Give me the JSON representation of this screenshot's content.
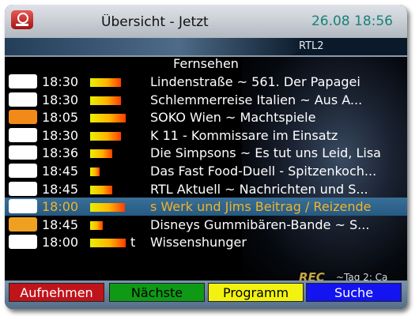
{
  "header": {
    "title": "Übersicht - Jetzt",
    "clock": "26.08 18:56",
    "channel": "RTL2"
  },
  "section_title": "Fernsehen",
  "rows": [
    {
      "logo": "festival",
      "time": "18:30",
      "progress": 0.85,
      "flag": "",
      "title": "Lindenstraße ~ 561. Der Papagei",
      "selected": false
    },
    {
      "logo": "plus",
      "time": "18:30",
      "progress": 0.85,
      "flag": "",
      "title": "Schlemmerreise Italien ~ Aus A...",
      "selected": false
    },
    {
      "logo": "zdf",
      "time": "18:05",
      "progress": 0.98,
      "flag": "",
      "title": "SOKO Wien ~ Machtspiele",
      "selected": false
    },
    {
      "logo": "sat1",
      "time": "18:30",
      "progress": 0.85,
      "flag": "",
      "title": "K 11 - Kommissare im Einsatz",
      "selected": false
    },
    {
      "logo": "pro7",
      "time": "18:36",
      "progress": 0.6,
      "flag": "",
      "title": "Die Simpsons ~ Es tut uns Leid, Lisa",
      "selected": false
    },
    {
      "logo": "kabel",
      "time": "18:45",
      "progress": 0.25,
      "flag": "",
      "title": "Das Fast Food-Duell - Spitzenkoch...",
      "selected": false
    },
    {
      "logo": "rtl",
      "time": "18:45",
      "progress": 0.6,
      "flag": "",
      "title": "RTL Aktuell ~ Nachrichten und S...",
      "selected": false
    },
    {
      "logo": "rtl2",
      "time": "18:00",
      "progress": 0.95,
      "flag": "",
      "title": "s Werk und Jims Beitrag / Reizende",
      "selected": true
    },
    {
      "logo": "super",
      "time": "18:45",
      "progress": 0.35,
      "flag": "",
      "title": "Disneys Gummibären-Bande ~ S...",
      "selected": false
    },
    {
      "logo": "vox",
      "time": "18:00",
      "progress": 0.97,
      "flag": "t",
      "title": "Wissenshunger",
      "selected": false
    }
  ],
  "rec": {
    "label": "REC",
    "tag": "~Tag 2: Ca"
  },
  "footer": {
    "red": "Aufnehmen",
    "green": "Nächste",
    "yellow": "Programm",
    "blue": "Suche"
  },
  "colors": {
    "header_clock": "#16827a",
    "selected_text": "#f2b42a",
    "selected_row": "#2f648d"
  }
}
